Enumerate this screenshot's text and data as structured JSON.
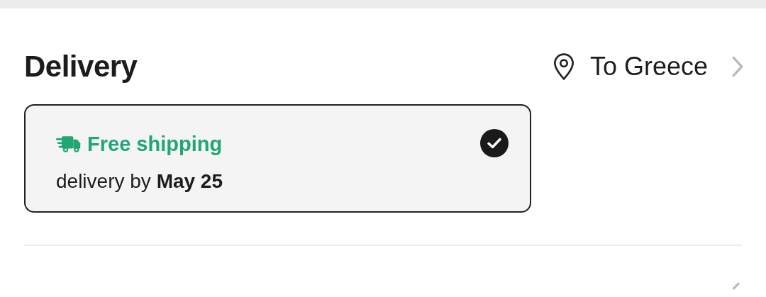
{
  "delivery": {
    "title": "Delivery",
    "destination": "To Greece",
    "options": [
      {
        "label": "Free shipping",
        "date_text": "delivery by **May 25**",
        "selected": true
      }
    ]
  }
}
